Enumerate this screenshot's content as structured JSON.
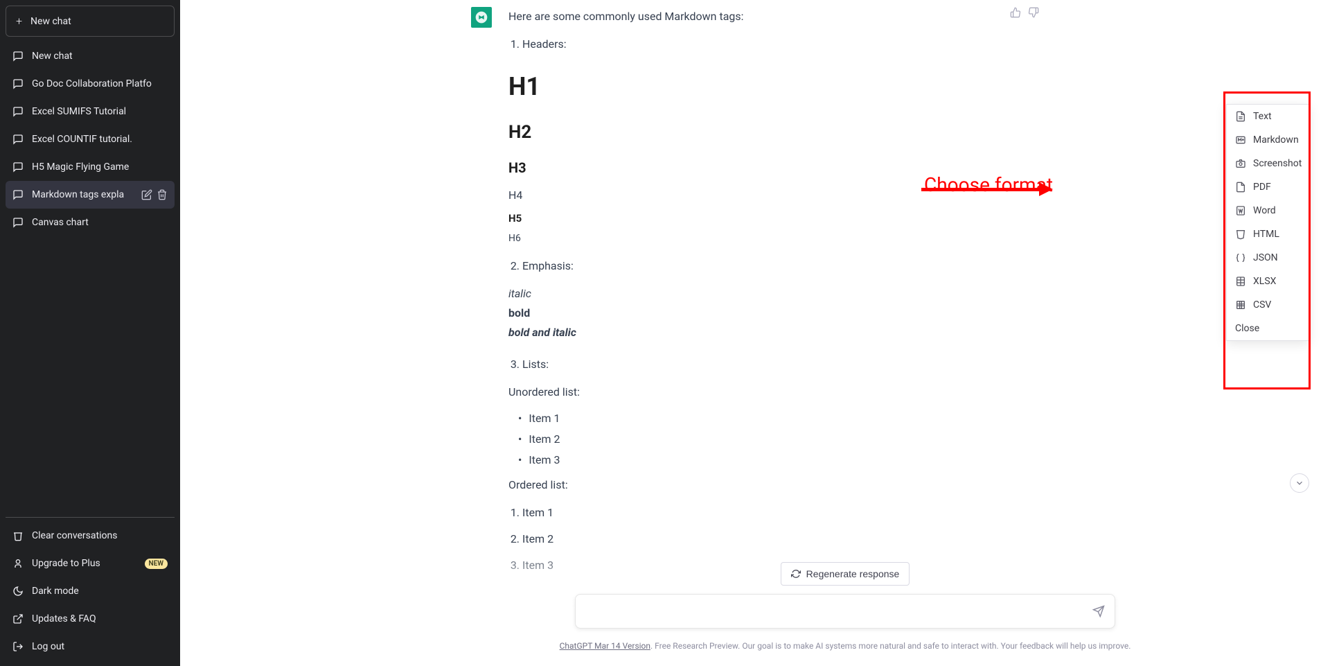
{
  "sidebar": {
    "new_chat": "New chat",
    "items": [
      {
        "label": "New chat"
      },
      {
        "label": "Go Doc Collaboration Platfo"
      },
      {
        "label": "Excel SUMIFS Tutorial"
      },
      {
        "label": "Excel COUNTIF tutorial."
      },
      {
        "label": "H5 Magic Flying Game"
      },
      {
        "label": "Markdown tags expla"
      },
      {
        "label": "Canvas chart"
      }
    ],
    "active_index": 5,
    "bottom": {
      "clear": "Clear conversations",
      "upgrade": "Upgrade to Plus",
      "new_badge": "NEW",
      "dark_mode": "Dark mode",
      "updates": "Updates & FAQ",
      "logout": "Log out"
    }
  },
  "message": {
    "intro": "Here are some commonly used Markdown tags:",
    "section1_label": "Headers:",
    "h1": "H1",
    "h2": "H2",
    "h3": "H3",
    "h4": "H4",
    "h5": "H5",
    "h6": "H6",
    "section2_label": "Emphasis:",
    "italic": "italic",
    "bold": "bold",
    "bolditalic": "bold and italic",
    "section3_label": "Lists:",
    "unordered_label": "Unordered list:",
    "ul_items": [
      "Item 1",
      "Item 2",
      "Item 3"
    ],
    "ordered_label": "Ordered list:",
    "ol_items": [
      "Item 1",
      "Item 2",
      "Item 3"
    ]
  },
  "controls": {
    "regenerate": "Regenerate response",
    "input_placeholder": ""
  },
  "footer": {
    "version": "ChatGPT Mar 14 Version",
    "text": ". Free Research Preview. Our goal is to make AI systems more natural and safe to interact with. Your feedback will help us improve."
  },
  "format_menu": {
    "items": [
      {
        "label": "Text",
        "icon": "file-text"
      },
      {
        "label": "Markdown",
        "icon": "markdown"
      },
      {
        "label": "Screenshot",
        "icon": "camera"
      },
      {
        "label": "PDF",
        "icon": "pdf"
      },
      {
        "label": "Word",
        "icon": "word"
      },
      {
        "label": "HTML",
        "icon": "html"
      },
      {
        "label": "JSON",
        "icon": "json"
      },
      {
        "label": "XLSX",
        "icon": "xlsx"
      },
      {
        "label": "CSV",
        "icon": "csv"
      }
    ],
    "close": "Close"
  },
  "annotation": {
    "label": "Choose format"
  }
}
